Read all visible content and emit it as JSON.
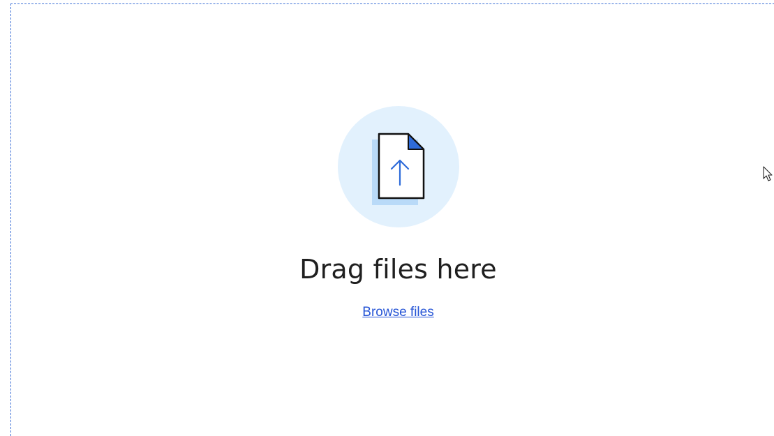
{
  "dropzone": {
    "title": "Drag files here",
    "browse_label": "Browse files",
    "icon": "file-upload-icon",
    "colors": {
      "border": "#3c6fd6",
      "circle_bg": "#e2f1fd",
      "accent": "#2e6bd9",
      "link": "#2554d6",
      "title_text": "#1f1f1f"
    }
  },
  "cursor": {
    "icon": "mouse-pointer-icon"
  }
}
